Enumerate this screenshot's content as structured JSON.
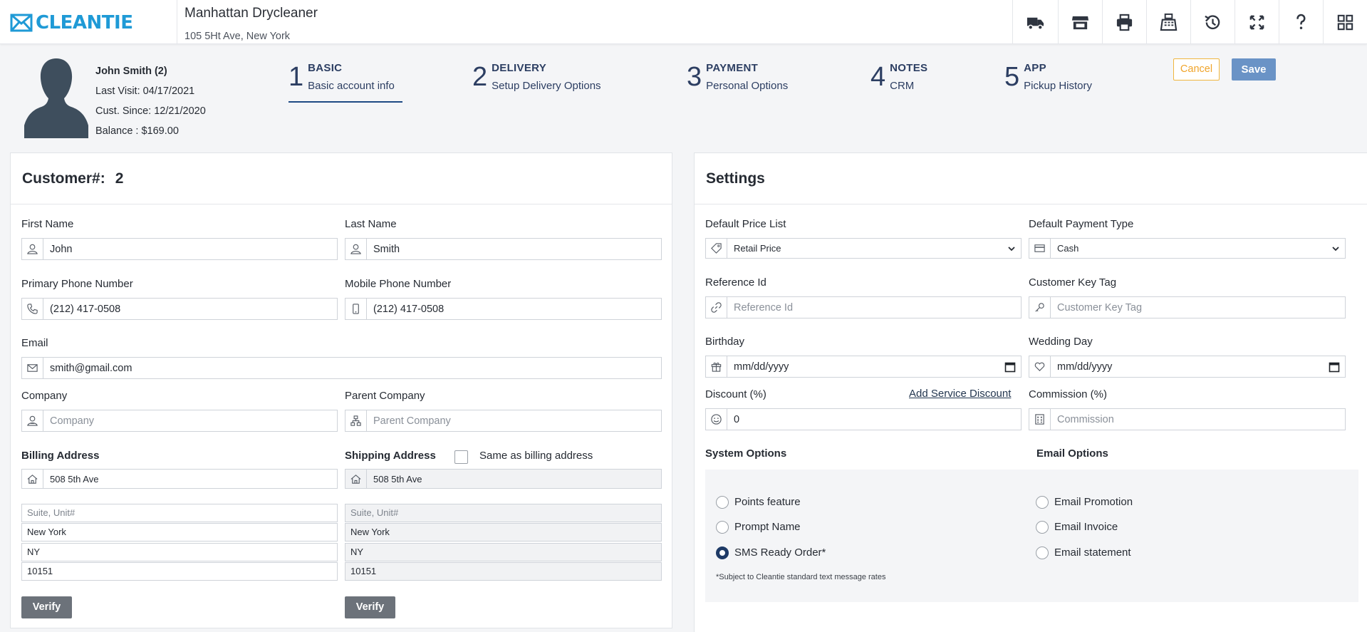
{
  "brand": {
    "name": "CLEANTIE",
    "color": "#1f9ad6"
  },
  "store": {
    "name": "Manhattan Drycleaner",
    "address": "105 5Ht Ave, New York"
  },
  "header_icons": [
    "delivery-truck-icon",
    "store-icon",
    "printer-icon",
    "cash-register-icon",
    "history-icon",
    "fullscreen-icon",
    "help-icon",
    "apps-grid-icon"
  ],
  "profile": {
    "name": "John Smith (2)",
    "last_visit": "Last Visit: 04/17/2021",
    "cust_since": "Cust. Since: 12/21/2020",
    "balance": "Balance : $169.00"
  },
  "steps": [
    {
      "num": "1",
      "title": "BASIC",
      "sub": "Basic account info",
      "active": true
    },
    {
      "num": "2",
      "title": "DELIVERY",
      "sub": "Setup Delivery Options"
    },
    {
      "num": "3",
      "title": "PAYMENT",
      "sub": "Personal Options"
    },
    {
      "num": "4",
      "title": "NOTES",
      "sub": "CRM"
    },
    {
      "num": "5",
      "title": "APP",
      "sub": "Pickup History"
    }
  ],
  "actions": {
    "cancel": "Cancel",
    "save": "Save"
  },
  "customer": {
    "title": "Customer#:",
    "number": "2",
    "first_name_label": "First Name",
    "first_name": "John",
    "last_name_label": "Last Name",
    "last_name": "Smith",
    "primary_phone_label": "Primary Phone Number",
    "primary_phone": "(212) 417-0508",
    "mobile_phone_label": "Mobile Phone Number",
    "mobile_phone": "(212) 417-0508",
    "email_label": "Email",
    "email": "smith@gmail.com",
    "company_label": "Company",
    "company_placeholder": "Company",
    "parent_company_label": "Parent Company",
    "parent_company_placeholder": "Parent Company",
    "billing_label": "Billing Address",
    "shipping_label": "Shipping Address",
    "same_as_billing": "Same as billing address",
    "billing": {
      "street": "508 5th Ave",
      "suite_placeholder": "Suite, Unit#",
      "city": "New York",
      "state": "NY",
      "zip": "10151"
    },
    "shipping": {
      "street": "508 5th Ave",
      "suite_placeholder": "Suite, Unit#",
      "city": "New York",
      "state": "NY",
      "zip": "10151"
    },
    "verify": "Verify"
  },
  "settings": {
    "title": "Settings",
    "price_list_label": "Default Price List",
    "price_list": "Retail Price",
    "payment_type_label": "Default Payment Type",
    "payment_type": "Cash",
    "reference_id_label": "Reference Id",
    "reference_id_placeholder": "Reference Id",
    "key_tag_label": "Customer Key Tag",
    "key_tag_placeholder": "Customer Key Tag",
    "birthday_label": "Birthday",
    "birthday_placeholder": "mm/dd/yyyy",
    "wedding_label": "Wedding Day",
    "wedding_placeholder": "mm/dd/yyyy",
    "discount_label": "Discount (%)",
    "discount": "0",
    "add_service_discount": "Add Service Discount",
    "commission_label": "Commission (%)",
    "commission_placeholder": "Commission",
    "system_options_label": "System Options",
    "email_options_label": "Email Options",
    "system_options": [
      {
        "label": "Points feature",
        "checked": false
      },
      {
        "label": "Prompt Name",
        "checked": false
      },
      {
        "label": "SMS Ready Order*",
        "checked": true
      }
    ],
    "email_options": [
      {
        "label": "Email Promotion",
        "checked": false
      },
      {
        "label": "Email Invoice",
        "checked": false
      },
      {
        "label": "Email statement",
        "checked": false
      }
    ],
    "sms_note": "*Subject to Cleantie standard text message rates"
  }
}
